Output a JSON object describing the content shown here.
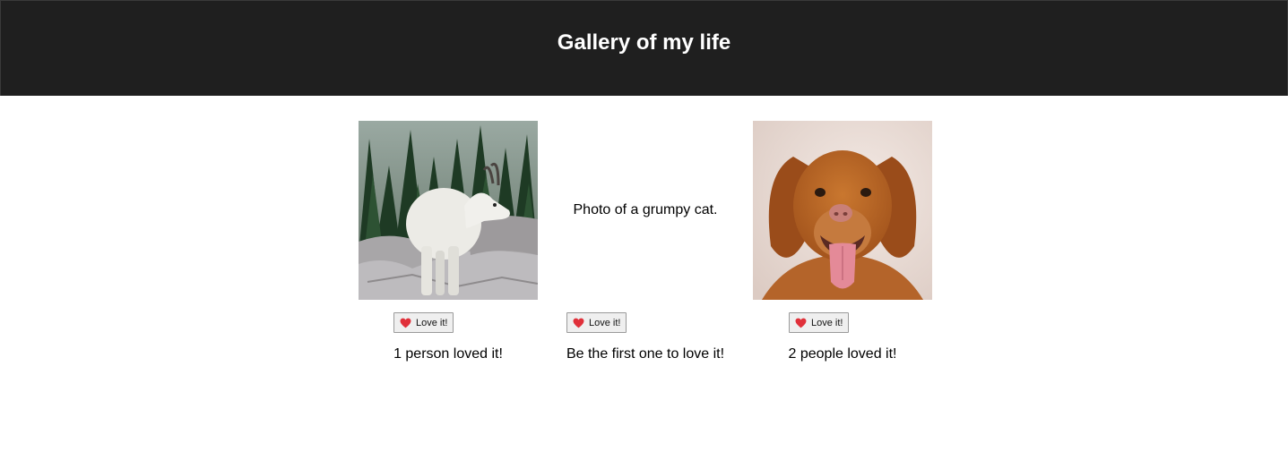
{
  "header": {
    "title": "Gallery of my life"
  },
  "gallery": {
    "items": [
      {
        "photo_icon": "mountain-goat-image",
        "button_label": "Love it!",
        "button_icon": "heart-icon",
        "count_text": "1 person loved it!"
      },
      {
        "alt_text": "Photo of a grumpy cat.",
        "button_label": "Love it!",
        "button_icon": "heart-icon",
        "count_text": "Be the first one to love it!"
      },
      {
        "photo_icon": "dog-image",
        "button_label": "Love it!",
        "button_icon": "heart-icon",
        "count_text": "2 people loved it!"
      }
    ]
  },
  "colors": {
    "header_bg": "#1f1f1f",
    "heart": "#e0303a"
  }
}
